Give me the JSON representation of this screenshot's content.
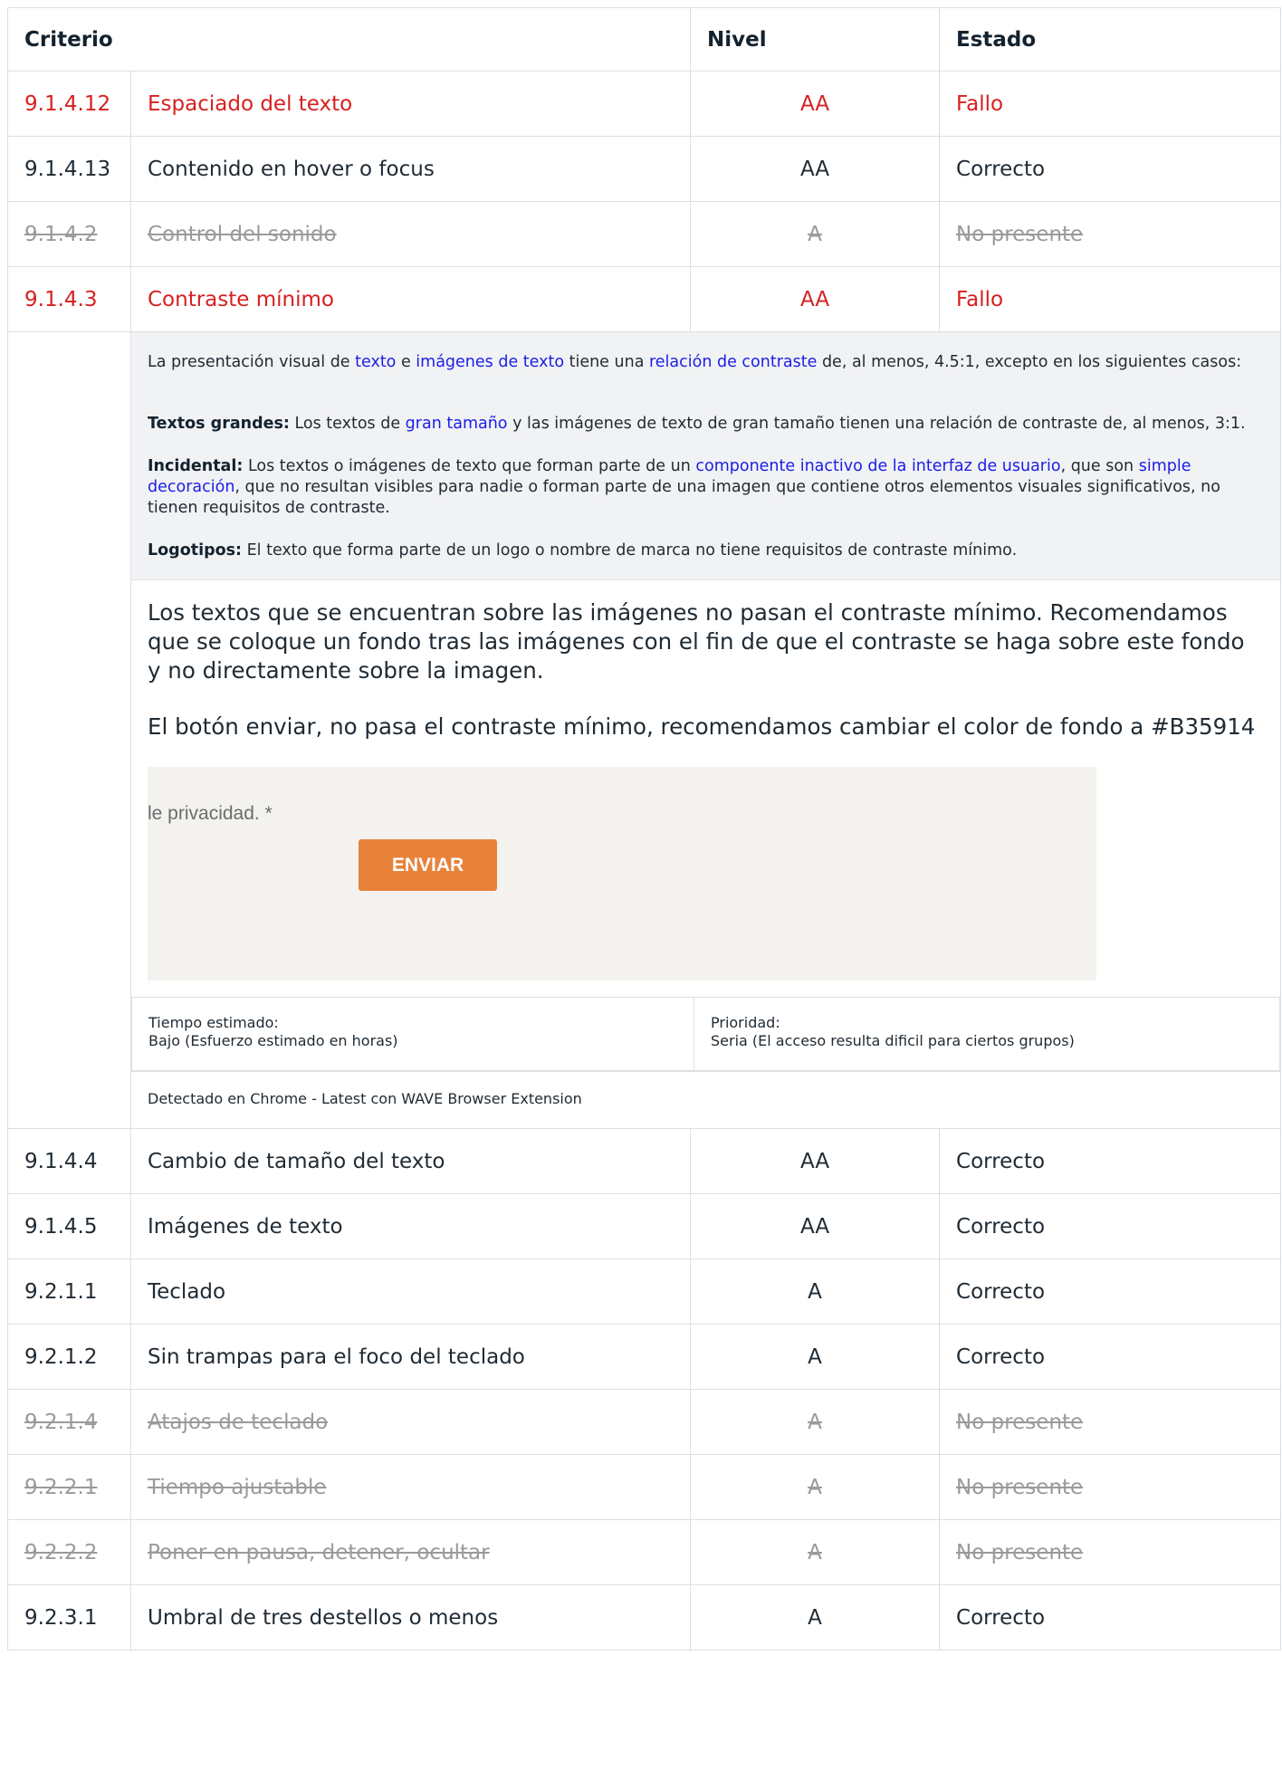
{
  "header": {
    "criterio": "Criterio",
    "nivel": "Nivel",
    "estado": "Estado"
  },
  "rows_top": [
    {
      "code": "9.1.4.12",
      "name": "Espaciado del texto",
      "level": "AA",
      "state": "Fallo",
      "status": "fail"
    },
    {
      "code": "9.1.4.13",
      "name": "Contenido en hover o focus",
      "level": "AA",
      "state": "Correcto",
      "status": "ok"
    },
    {
      "code": "9.1.4.2",
      "name": "Control del sonido",
      "level": "A",
      "state": "No presente",
      "status": "na"
    },
    {
      "code": "9.1.4.3",
      "name": "Contraste mínimo",
      "level": "AA",
      "state": "Fallo",
      "status": "fail"
    }
  ],
  "detail": {
    "wcag": {
      "p1_a": "La presentación visual de ",
      "p1_link1": "texto",
      "p1_b": " e ",
      "p1_link2": "imágenes de texto",
      "p1_c": " tiene una ",
      "p1_link3": "relación de contraste",
      "p1_d": " de, al menos, 4.5:1, excepto en los siguientes casos:",
      "p2_label": "Textos grandes:",
      "p2_a": " Los textos de ",
      "p2_link": "gran tamaño",
      "p2_b": " y las imágenes de texto de gran tamaño tienen una relación de contraste de, al menos, 3:1.",
      "p3_label": "Incidental:",
      "p3_a": " Los textos o imágenes de texto que forman parte de un ",
      "p3_link1": "componente inactivo de la interfaz de usuario",
      "p3_b": ", que son ",
      "p3_link2": "simple decoración",
      "p3_c": ", que no resultan visibles para nadie o forman parte de una imagen que contiene otros elementos visuales significativos, no tienen requisitos de contraste.",
      "p4_label": "Logotipos:",
      "p4_a": " El texto que forma parte de un logo o nombre de marca no tiene requisitos de contraste mínimo."
    },
    "finding": {
      "note1": "Los textos que se encuentran sobre las imágenes no pasan el contraste mínimo. Recomendamos que se coloque un fondo tras las imágenes con el fin de que el contraste se haga sobre este fondo y no directamente sobre la imagen.",
      "note2": "El botón enviar, no pasa el contraste mínimo, recomendamos cambiar el color de fondo a #B35914"
    },
    "screenshot": {
      "privacy_text": "le privacidad. *",
      "button_label": "ENVIAR"
    },
    "meta": {
      "time_label": "Tiempo estimado:",
      "time_value": "Bajo (Esfuerzo estimado en horas)",
      "priority_label": "Prioridad:",
      "priority_value": "Seria (El acceso resulta dificil para ciertos grupos)"
    },
    "detected": "Detectado en Chrome - Latest con WAVE Browser Extension"
  },
  "rows_bottom": [
    {
      "code": "9.1.4.4",
      "name": "Cambio de tamaño del texto",
      "level": "AA",
      "state": "Correcto",
      "status": "ok"
    },
    {
      "code": "9.1.4.5",
      "name": "Imágenes de texto",
      "level": "AA",
      "state": "Correcto",
      "status": "ok"
    },
    {
      "code": "9.2.1.1",
      "name": "Teclado",
      "level": "A",
      "state": "Correcto",
      "status": "ok"
    },
    {
      "code": "9.2.1.2",
      "name": "Sin trampas para el foco del teclado",
      "level": "A",
      "state": "Correcto",
      "status": "ok"
    },
    {
      "code": "9.2.1.4",
      "name": "Atajos de teclado",
      "level": "A",
      "state": "No presente",
      "status": "na"
    },
    {
      "code": "9.2.2.1",
      "name": "Tiempo ajustable",
      "level": "A",
      "state": "No presente",
      "status": "na"
    },
    {
      "code": "9.2.2.2",
      "name": "Poner en pausa, detener, ocultar",
      "level": "A",
      "state": "No presente",
      "status": "na"
    },
    {
      "code": "9.2.3.1",
      "name": "Umbral de tres destellos o menos",
      "level": "A",
      "state": "Correcto",
      "status": "ok"
    }
  ],
  "colors": {
    "fail": "#d62020",
    "na": "#9a9a9a",
    "link": "#1a1ee6",
    "button": "#e8823a"
  }
}
